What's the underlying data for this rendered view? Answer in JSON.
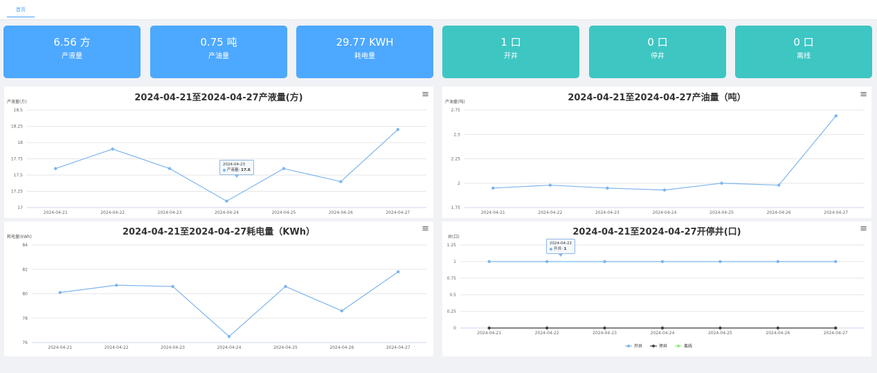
{
  "tabs": [
    {
      "label": "首页"
    }
  ],
  "cards": [
    {
      "value": "6.56 方",
      "label": "产液量",
      "color": "#4da8ff"
    },
    {
      "value": "0.75 吨",
      "label": "产油量",
      "color": "#4da8ff"
    },
    {
      "value": "29.77 KWH",
      "label": "耗电量",
      "color": "#4da8ff"
    },
    {
      "value": "1 口",
      "label": "开井",
      "color": "#3ec6c3"
    },
    {
      "value": "0 口",
      "label": "停井",
      "color": "#3ec6c3"
    },
    {
      "value": "0 口",
      "label": "离线",
      "color": "#3ec6c3"
    }
  ],
  "chart_data": [
    {
      "type": "line",
      "title": "2024-04-21至2024-04-27产液量(方)",
      "ylabel": "产液量(方)",
      "categories": [
        "2024-04-21",
        "2024-04-22",
        "2024-04-23",
        "2024-04-24",
        "2024-04-25",
        "2024-04-26",
        "2024-04-27"
      ],
      "yticks": [
        "17",
        "17.25",
        "17.5",
        "17.75",
        "18",
        "18.25",
        "18.5"
      ],
      "ylim": [
        17,
        18.5
      ],
      "series": [
        {
          "name": "产液量",
          "color": "#7cb5ec",
          "values": [
            17.6,
            17.9,
            17.6,
            17.1,
            17.6,
            17.4,
            18.2
          ]
        }
      ],
      "tooltip": {
        "date": "2024-04-23",
        "series": "产液量",
        "value": "17.6"
      }
    },
    {
      "type": "line",
      "title": "2024-04-21至2024-04-27产油量（吨）",
      "ylabel": "产油量(吨)",
      "categories": [
        "2024-04-21",
        "2024-04-22",
        "2024-04-23",
        "2024-04-24",
        "2024-04-25",
        "2024-04-26",
        "2024-04-27"
      ],
      "yticks": [
        "1.75",
        "2",
        "2.25",
        "2.5",
        "2.75"
      ],
      "ylim": [
        1.75,
        2.75
      ],
      "series": [
        {
          "name": "产油量",
          "color": "#7cb5ec",
          "values": [
            1.95,
            1.98,
            1.95,
            1.93,
            2.0,
            1.98,
            2.69
          ]
        }
      ]
    },
    {
      "type": "line",
      "title": "2024-04-21至2024-04-27耗电量（KWh）",
      "ylabel": "耗电量(kWh)",
      "categories": [
        "2024-04-21",
        "2024-04-22",
        "2024-04-23",
        "2024-04-24",
        "2024-04-25",
        "2024-04-26",
        "2024-04-27"
      ],
      "yticks": [
        "76",
        "78",
        "80",
        "82",
        "84"
      ],
      "ylim": [
        76,
        84
      ],
      "series": [
        {
          "name": "耗电量",
          "color": "#7cb5ec",
          "values": [
            80.1,
            80.7,
            80.6,
            76.5,
            80.6,
            78.6,
            81.8
          ]
        }
      ]
    },
    {
      "type": "line",
      "title": "2024-04-21至2024-04-27开停井(口)",
      "ylabel": "井(口)",
      "categories": [
        "2024-04-21",
        "2024-04-22",
        "2024-04-23",
        "2024-04-24",
        "2024-04-25",
        "2024-04-26",
        "2024-04-27"
      ],
      "yticks": [
        "0",
        "0.25",
        "0.5",
        "0.75",
        "1",
        "1.25"
      ],
      "ylim": [
        0,
        1.25
      ],
      "series": [
        {
          "name": "开井",
          "color": "#7cb5ec",
          "values": [
            1,
            1,
            1,
            1,
            1,
            1,
            1
          ]
        },
        {
          "name": "停井",
          "color": "#434348",
          "values": [
            0,
            0,
            0,
            0,
            0,
            0,
            0
          ]
        },
        {
          "name": "离线",
          "color": "#90ed7d",
          "values": [
            0,
            0,
            0,
            0,
            0,
            0,
            0
          ]
        }
      ],
      "legend": "bottom",
      "tooltip": {
        "date": "2024-04-22",
        "series": "开井",
        "value": "1"
      }
    }
  ]
}
